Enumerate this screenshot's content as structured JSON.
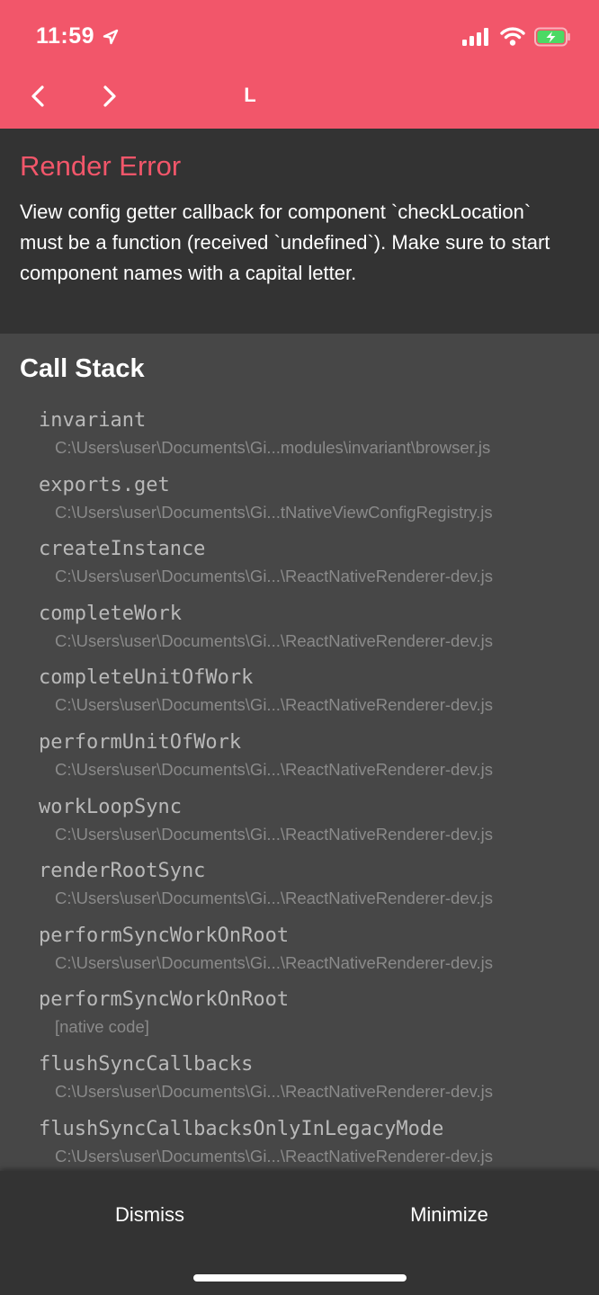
{
  "status_bar": {
    "time": "11:59",
    "icons": [
      "location-arrow-icon",
      "cellular-signal-icon",
      "wifi-icon",
      "battery-charging-icon"
    ],
    "battery_color": "#4cd964"
  },
  "nav": {
    "title": "L",
    "back_icon": "chevron-left-icon",
    "forward_icon": "chevron-right-icon"
  },
  "colors": {
    "header_bg": "#f2566a",
    "error_title": "#f2566a",
    "panel_bg": "#333333",
    "body_bg": "#474747"
  },
  "error": {
    "title": "Render Error",
    "message": "View config getter callback for component `checkLocation` must be a function (received `undefined`). Make sure to start component names with a capital letter."
  },
  "call_stack": {
    "title": "Call Stack",
    "frames": [
      {
        "name": "invariant",
        "file": "C:\\Users\\user\\Documents\\Gi...modules\\invariant\\browser.js"
      },
      {
        "name": "exports.get",
        "file": "C:\\Users\\user\\Documents\\Gi...tNativeViewConfigRegistry.js"
      },
      {
        "name": "createInstance",
        "file": "C:\\Users\\user\\Documents\\Gi...\\ReactNativeRenderer-dev.js"
      },
      {
        "name": "completeWork",
        "file": "C:\\Users\\user\\Documents\\Gi...\\ReactNativeRenderer-dev.js"
      },
      {
        "name": "completeUnitOfWork",
        "file": "C:\\Users\\user\\Documents\\Gi...\\ReactNativeRenderer-dev.js"
      },
      {
        "name": "performUnitOfWork",
        "file": "C:\\Users\\user\\Documents\\Gi...\\ReactNativeRenderer-dev.js"
      },
      {
        "name": "workLoopSync",
        "file": "C:\\Users\\user\\Documents\\Gi...\\ReactNativeRenderer-dev.js"
      },
      {
        "name": "renderRootSync",
        "file": "C:\\Users\\user\\Documents\\Gi...\\ReactNativeRenderer-dev.js"
      },
      {
        "name": "performSyncWorkOnRoot",
        "file": "C:\\Users\\user\\Documents\\Gi...\\ReactNativeRenderer-dev.js"
      },
      {
        "name": "performSyncWorkOnRoot",
        "file": "[native code]"
      },
      {
        "name": "flushSyncCallbacks",
        "file": "C:\\Users\\user\\Documents\\Gi...\\ReactNativeRenderer-dev.js"
      },
      {
        "name": "flushSyncCallbacksOnlyInLegacyMode",
        "file": "C:\\Users\\user\\Documents\\Gi...\\ReactNativeRenderer-dev.js"
      }
    ]
  },
  "footer": {
    "dismiss_label": "Dismiss",
    "minimize_label": "Minimize"
  }
}
